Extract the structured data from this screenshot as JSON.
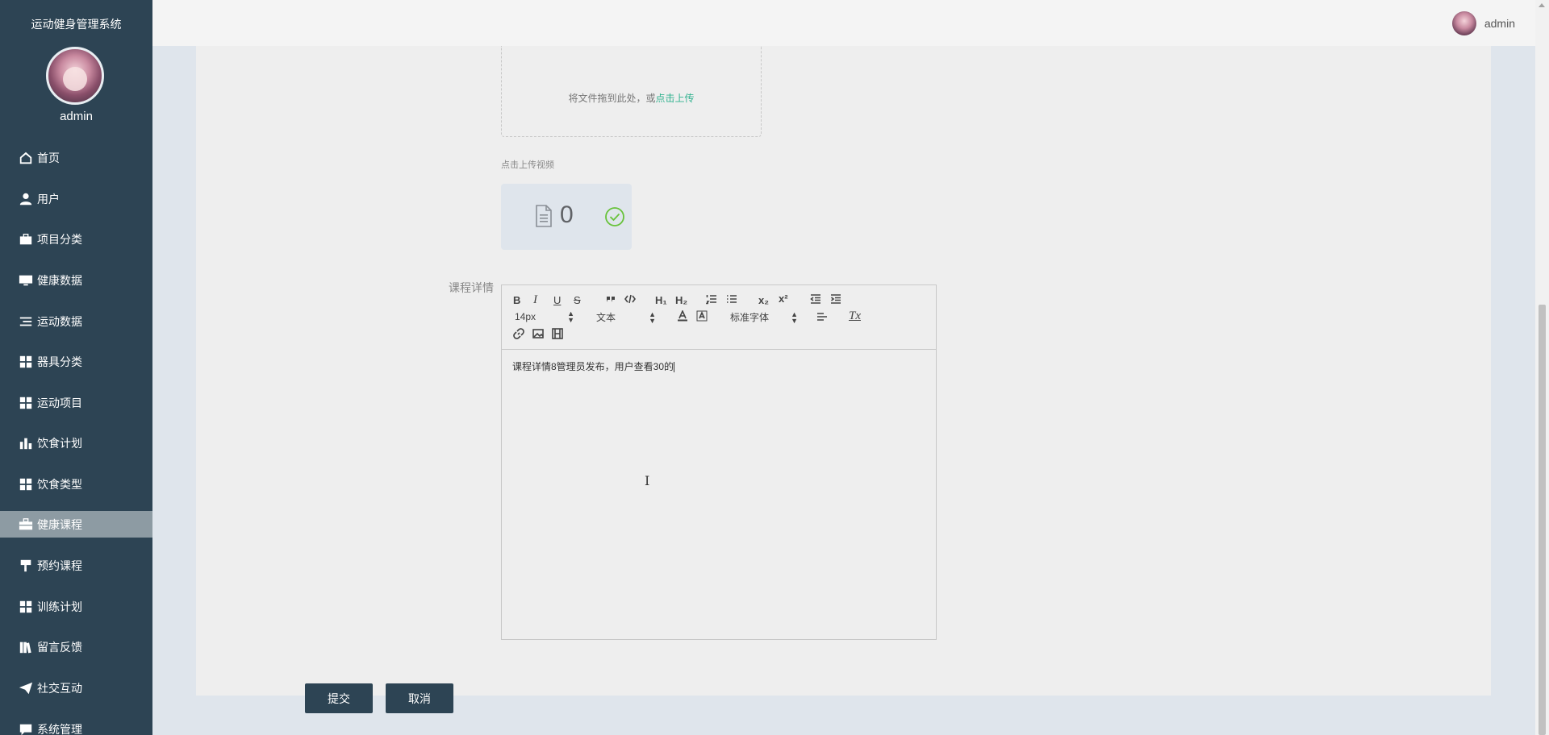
{
  "app": {
    "title": "运动健身管理系统",
    "username": "admin"
  },
  "topbar": {
    "username": "admin"
  },
  "sidebar": {
    "items": [
      {
        "label": "首页",
        "icon": "home-icon"
      },
      {
        "label": "用户",
        "icon": "user-icon"
      },
      {
        "label": "项目分类",
        "icon": "briefcase-icon"
      },
      {
        "label": "健康数据",
        "icon": "monitor-icon"
      },
      {
        "label": "运动数据",
        "icon": "list-icon"
      },
      {
        "label": "器具分类",
        "icon": "grid-icon"
      },
      {
        "label": "运动项目",
        "icon": "grid-icon"
      },
      {
        "label": "饮食计划",
        "icon": "bar-chart-icon"
      },
      {
        "label": "饮食类型",
        "icon": "grid-icon"
      },
      {
        "label": "健康课程",
        "icon": "toolbox-icon",
        "active": true
      },
      {
        "label": "预约课程",
        "icon": "paint-roller-icon"
      },
      {
        "label": "训练计划",
        "icon": "grid-icon"
      },
      {
        "label": "留言反馈",
        "icon": "books-icon"
      },
      {
        "label": "社交互动",
        "icon": "paper-plane-icon"
      },
      {
        "label": "系统管理",
        "icon": "chat-icon"
      }
    ]
  },
  "form": {
    "upload": {
      "tip_prefix": "将文件拖到此处，或",
      "tip_link": "点击上传"
    },
    "video": {
      "label": "点击上传视频",
      "count": "0"
    },
    "detail": {
      "label": "课程详情",
      "content": "课程详情8管理员发布，用户查看30的",
      "toolbar": {
        "bold": "B",
        "italic": "I",
        "underline": "U",
        "strike": "S",
        "h1": "H₁",
        "h2": "H₂",
        "sub": "x₂",
        "sup": "x²",
        "size": "14px",
        "header": "文本",
        "font": "标准字体",
        "clean": "Tx"
      }
    },
    "submit_label": "提交",
    "cancel_label": "取消"
  },
  "colors": {
    "sidebar_bg": "#2d4454",
    "active_item_bg": "#8d9ba3",
    "accent_link": "#31b28f",
    "success": "#67c23a"
  }
}
